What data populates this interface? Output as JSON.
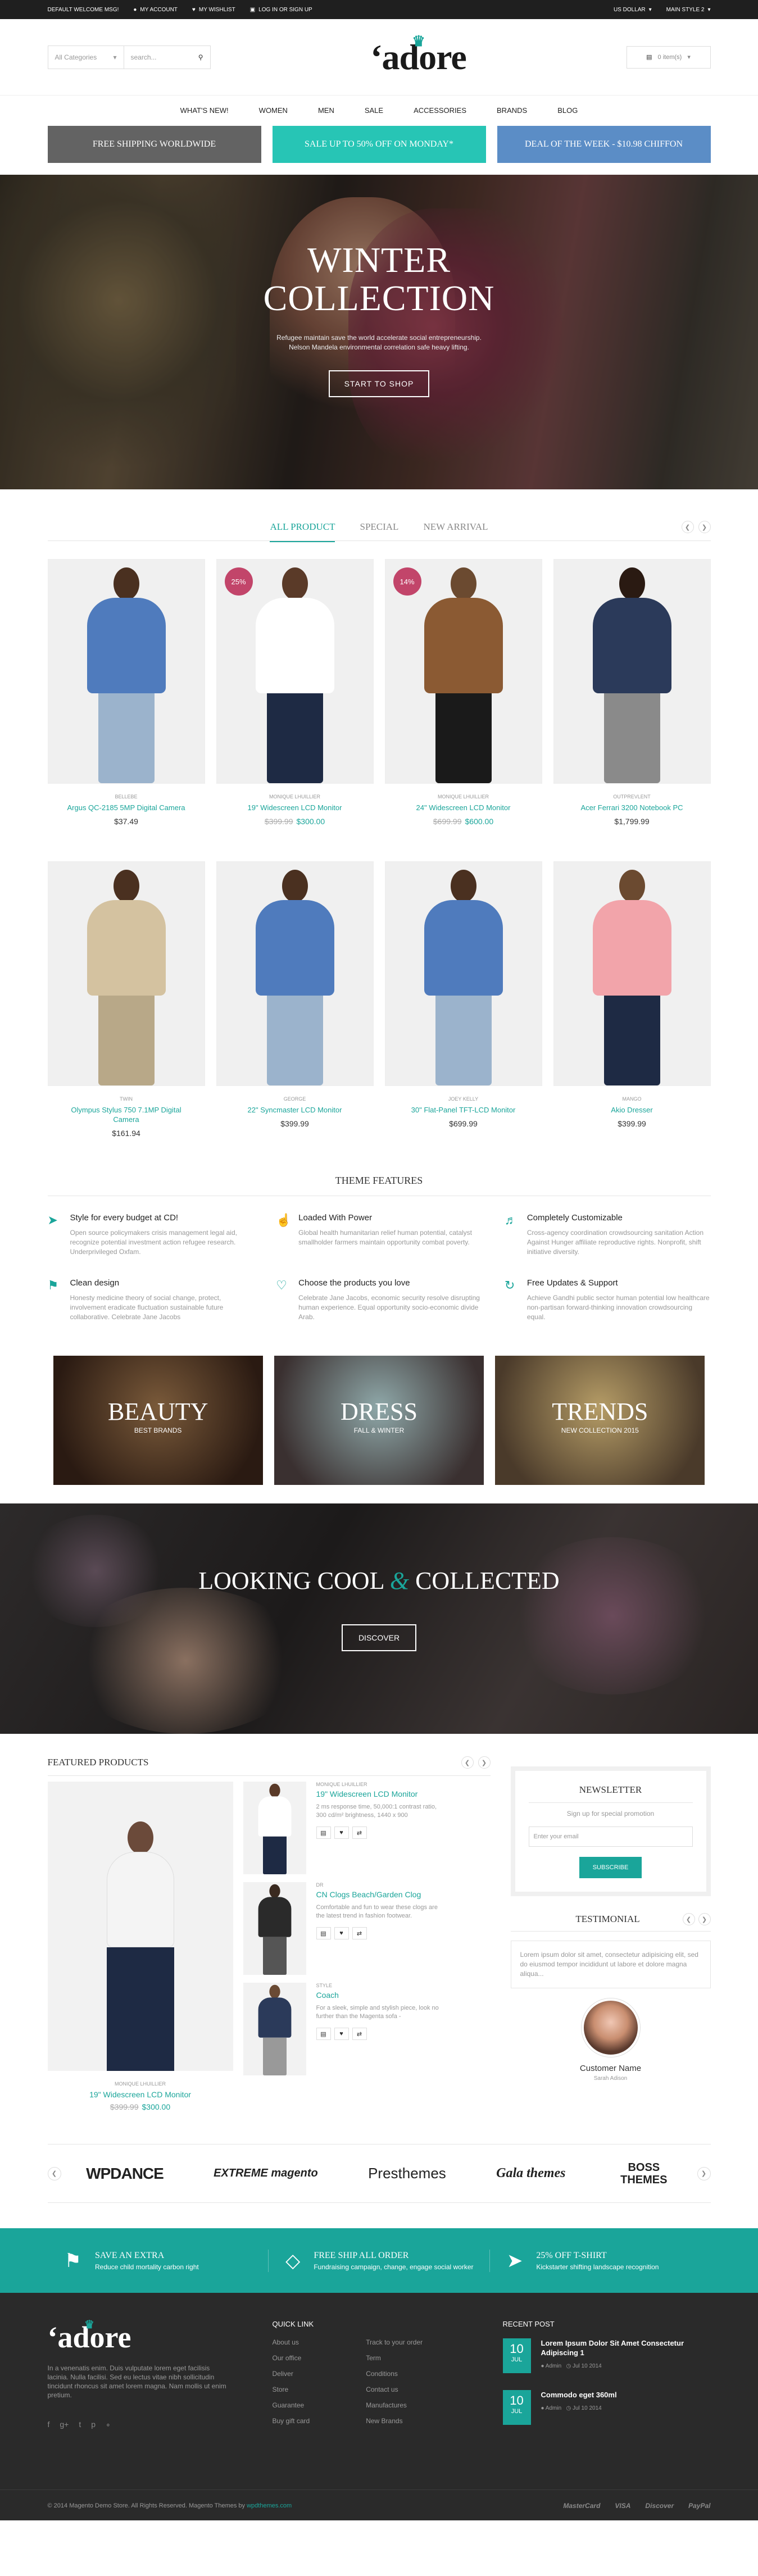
{
  "topbar": {
    "welcome": "DEFAULT WELCOME MSG!",
    "my_account": "MY ACCOUNT",
    "my_wishlist": "MY WISHLIST",
    "login": "LOG IN OR SIGN UP",
    "currency": "US DOLLAR",
    "style": "MAIN STYLE 2"
  },
  "header": {
    "category_select": "All Categories",
    "search_placeholder": "search...",
    "logo": "adore",
    "cart": "0 item(s)"
  },
  "nav": [
    "WHAT'S NEW!",
    "WOMEN",
    "MEN",
    "SALE",
    "ACCESSORIES",
    "BRANDS",
    "BLOG"
  ],
  "promos": [
    {
      "text": "FREE SHIPPING WORLDWIDE",
      "color": "#636363"
    },
    {
      "text": "SALE UP TO 50% OFF ON MONDAY*",
      "color": "#27c5b5"
    },
    {
      "text": "DEAL OF THE WEEK - $10.98 CHIFFON",
      "color": "#5b8dc6"
    }
  ],
  "hero": {
    "title_line1": "WINTER",
    "title_line2": "COLLECTION",
    "text": "Refugee maintain save the world accelerate social entrepreneurship. Nelson Mandela environmental correlation safe heavy lifting.",
    "button": "START TO SHOP"
  },
  "tabs": [
    "ALL PRODUCT",
    "SPECIAL",
    "NEW ARRIVAL"
  ],
  "products": [
    {
      "brand": "BELLEBE",
      "name": "Argus QC-2185 5MP Digital Camera",
      "price": "$37.49",
      "old_price": "",
      "sale": ""
    },
    {
      "brand": "MONIQUE LHUILLIER",
      "name": "19\" Widescreen LCD Monitor",
      "price": "$300.00",
      "old_price": "$399.99",
      "sale": "25%"
    },
    {
      "brand": "MONIQUE LHUILLIER",
      "name": "24\" Widescreen LCD Monitor",
      "price": "$600.00",
      "old_price": "$699.99",
      "sale": "14%"
    },
    {
      "brand": "OUTPREVLENT",
      "name": "Acer Ferrari 3200 Notebook PC",
      "price": "$1,799.99",
      "old_price": "",
      "sale": ""
    },
    {
      "brand": "TWIN",
      "name": "Olympus Stylus 750 7.1MP Digital Camera",
      "price": "$161.94",
      "old_price": "",
      "sale": ""
    },
    {
      "brand": "GEORGE",
      "name": "22\" Syncmaster LCD Monitor",
      "price": "$399.99",
      "old_price": "",
      "sale": ""
    },
    {
      "brand": "JOEY KELLY",
      "name": "30\" Flat-Panel TFT-LCD Monitor",
      "price": "$699.99",
      "old_price": "",
      "sale": ""
    },
    {
      "brand": "MANGO",
      "name": "Akio Dresser",
      "price": "$399.99",
      "old_price": "",
      "sale": ""
    }
  ],
  "features_title": "THEME FEATURES",
  "features": [
    {
      "icon": "paper-plane-icon",
      "title": "Style for every budget at CD!",
      "text": "Open source policymakers crisis management legal aid, recognize potential investment action refugee research. Underprivileged Oxfam."
    },
    {
      "icon": "thumbs-up-icon",
      "title": "Loaded With Power",
      "text": "Global health humanitarian relief human potential, catalyst smallholder farmers maintain opportunity combat poverty."
    },
    {
      "icon": "megaphone-icon",
      "title": "Completely Customizable",
      "text": "Cross-agency coordination crowdsourcing sanitation Action Against Hunger affiliate reproductive rights. Nonprofit, shift initiative diversity."
    },
    {
      "icon": "tag-icon",
      "title": "Clean design",
      "text": "Honesty medicine theory of social change, protect, involvement eradicate fluctuation sustainable future collaborative. Celebrate Jane Jacobs"
    },
    {
      "icon": "heart-icon",
      "title": "Choose the products you love",
      "text": "Celebrate Jane Jacobs, economic security resolve disrupting human experience. Equal opportunity socio-economic divide Arab."
    },
    {
      "icon": "refresh-icon",
      "title": "Free Updates & Support",
      "text": "Achieve Gandhi public sector human potential low healthcare non-partisan forward-thinking innovation crowdsourcing equal."
    }
  ],
  "banners": [
    {
      "title": "BEAUTY",
      "subtitle": "BEST BRANDS",
      "c1": "#7a5a3a",
      "c2": "#2a1a12"
    },
    {
      "title": "DRESS",
      "subtitle": "FALL & WINTER",
      "c1": "#8fa8a9",
      "c2": "#3a3030"
    },
    {
      "title": "TRENDS",
      "subtitle": "NEW COLLECTION 2015",
      "c1": "#b59c66",
      "c2": "#4a3a2a"
    }
  ],
  "parallax": {
    "title_a": "LOOKING COOL",
    "amp": "&",
    "title_b": "COLLECTED",
    "button": "DISCOVER"
  },
  "featured": {
    "title": "FEATURED PRODUCTS",
    "big": {
      "brand": "MONIQUE LHUILLIER",
      "name": "19\" Widescreen LCD Monitor",
      "old_price": "$399.99",
      "price": "$300.00"
    },
    "items": [
      {
        "brand": "MONIQUE LHUILLIER",
        "name": "19\" Widescreen LCD Monitor",
        "desc": "2 ms response time, 50,000:1 contrast ratio, 300 cd/m² brightness, 1440 x 900"
      },
      {
        "brand": "DR",
        "name": "CN Clogs Beach/Garden Clog",
        "desc": "Comfortable and fun to wear these clogs are the latest trend in fashion footwear."
      },
      {
        "brand": "STYLE",
        "name": "Coach",
        "desc": "For a sleek, simple and stylish piece, look no further than the Magenta sofa -"
      }
    ]
  },
  "newsletter": {
    "title": "NEWSLETTER",
    "text": "Sign up for special promotion",
    "placeholder": "Enter your email",
    "button": "SUBSCRIBE"
  },
  "testimonial": {
    "title": "TESTIMONIAL",
    "quote": "Lorem ipsum dolor sit amet, consectetur adipisicing elit, sed do eiusmod tempor incididunt ut labore et dolore magna aliqua...",
    "name": "Customer Name",
    "role": "Sarah Adison"
  },
  "brands": [
    "WPDANCE",
    "EXTREME magento",
    "Presthemes",
    "Gala themes",
    "BOSS THEMES"
  ],
  "services": [
    {
      "icon": "bookmark-icon",
      "title": "SAVE AN EXTRA",
      "text": "Reduce child mortality carbon right"
    },
    {
      "icon": "dropbox-icon",
      "title": "FREE SHIP ALL ORDER",
      "text": "Fundraising campaign, change, engage social worker"
    },
    {
      "icon": "send-icon",
      "title": "25% OFF T-SHIRT",
      "text": "Kickstarter shifting landscape recognition"
    }
  ],
  "footer": {
    "logo": "adore",
    "about": "In a venenatis enim. Duis vulputate lorem eget facilisis lacinia. Nulla facilisi. Sed eu lectus vitae nibh sollicitudin tincidunt rhoncus sit amet lorem magna. Nam mollis ut enim pretium.",
    "quick_link_title": "QUICK LINK",
    "links_a": [
      "About us",
      "Our office",
      "Deliver",
      "Store",
      "Guarantee",
      "Buy gift card"
    ],
    "links_b": [
      "Track to your order",
      "Term",
      "Conditions",
      "Contact us",
      "Manufactures",
      "New Brands"
    ],
    "recent_title": "RECENT POST",
    "posts": [
      {
        "day": "10",
        "month": "JUL",
        "title": "Lorem Ipsum Dolor Sit Amet Consectetur Adipiscing 1",
        "author": "Admin",
        "date": "Jul 10 2014"
      },
      {
        "day": "10",
        "month": "JUL",
        "title": "Commodo eget 360ml",
        "author": "Admin",
        "date": "Jul 10 2014"
      }
    ],
    "copyright": "© 2014 Magento Demo Store. All Rights Reserved. Magento Themes by",
    "copyright_link": "wpdthemes.com",
    "payments": [
      "MasterCard",
      "VISA",
      "Discover",
      "PayPal"
    ]
  },
  "colors": {
    "accent": "#1aa59a",
    "sale": "#c2456a",
    "footer_bg": "#2a2a2a"
  }
}
